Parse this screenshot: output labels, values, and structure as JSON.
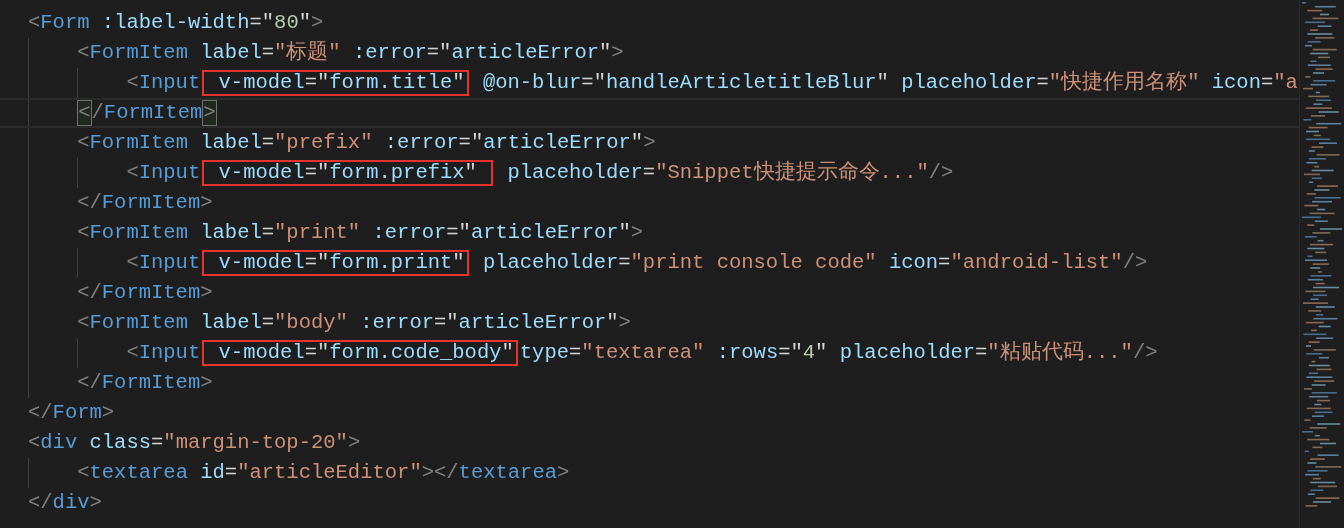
{
  "editor": {
    "lines": [
      {
        "tokens": [
          {
            "kind": "punct",
            "text": "<"
          },
          {
            "kind": "tag",
            "text": "Form"
          },
          {
            "kind": "attr",
            "text": " :label-width"
          },
          {
            "kind": "eq",
            "text": "=\""
          },
          {
            "kind": "num",
            "text": "80"
          },
          {
            "kind": "eq",
            "text": "\""
          },
          {
            "kind": "punct",
            "text": ">"
          }
        ],
        "children": [
          {
            "tokens": [
              {
                "kind": "punct",
                "text": "<"
              },
              {
                "kind": "tag",
                "text": "FormItem"
              },
              {
                "kind": "attr",
                "text": " label"
              },
              {
                "kind": "eq",
                "text": "="
              },
              {
                "kind": "str",
                "text": "\"标题\""
              },
              {
                "kind": "attr",
                "text": " :error"
              },
              {
                "kind": "eq",
                "text": "=\""
              },
              {
                "kind": "expr",
                "text": "articleError"
              },
              {
                "kind": "eq",
                "text": "\""
              },
              {
                "kind": "punct",
                "text": ">"
              }
            ],
            "children": [
              {
                "tokens": [
                  {
                    "kind": "punct",
                    "text": "<"
                  },
                  {
                    "kind": "tag",
                    "text": "Input"
                  },
                  {
                    "kind": "group",
                    "marked": true,
                    "tokens": [
                      {
                        "kind": "attr",
                        "text": " v-model"
                      },
                      {
                        "kind": "eq",
                        "text": "=\""
                      },
                      {
                        "kind": "expr",
                        "text": "form.title"
                      },
                      {
                        "kind": "eq",
                        "text": "\""
                      }
                    ]
                  },
                  {
                    "kind": "attr",
                    "text": " @on-blur"
                  },
                  {
                    "kind": "eq",
                    "text": "=\""
                  },
                  {
                    "kind": "expr",
                    "text": "handleArticletitleBlur"
                  },
                  {
                    "kind": "eq",
                    "text": "\""
                  },
                  {
                    "kind": "attr",
                    "text": " placeholder"
                  },
                  {
                    "kind": "eq",
                    "text": "="
                  },
                  {
                    "kind": "str",
                    "text": "\"快捷作用名称\""
                  },
                  {
                    "kind": "attr",
                    "text": " icon"
                  },
                  {
                    "kind": "eq",
                    "text": "="
                  },
                  {
                    "kind": "str",
                    "text": "\"a"
                  }
                ]
              }
            ]
          },
          {
            "current": true,
            "tokens": [
              {
                "kind": "punct",
                "text": "<",
                "bracket_match": true
              },
              {
                "kind": "punct",
                "text": "/"
              },
              {
                "kind": "tag",
                "text": "FormItem"
              },
              {
                "kind": "punct",
                "text": ">",
                "bracket_match": true
              }
            ]
          },
          {
            "tokens": [
              {
                "kind": "punct",
                "text": "<"
              },
              {
                "kind": "tag",
                "text": "FormItem"
              },
              {
                "kind": "attr",
                "text": " label"
              },
              {
                "kind": "eq",
                "text": "="
              },
              {
                "kind": "str",
                "text": "\"prefix\""
              },
              {
                "kind": "attr",
                "text": " :error"
              },
              {
                "kind": "eq",
                "text": "=\""
              },
              {
                "kind": "expr",
                "text": "articleError"
              },
              {
                "kind": "eq",
                "text": "\""
              },
              {
                "kind": "punct",
                "text": ">"
              }
            ],
            "children": [
              {
                "tokens": [
                  {
                    "kind": "punct",
                    "text": "<"
                  },
                  {
                    "kind": "tag",
                    "text": "Input"
                  },
                  {
                    "kind": "group",
                    "marked": true,
                    "tokens": [
                      {
                        "kind": "attr",
                        "text": " v-model"
                      },
                      {
                        "kind": "eq",
                        "text": "=\""
                      },
                      {
                        "kind": "expr",
                        "text": "form.prefix"
                      },
                      {
                        "kind": "eq",
                        "text": "\" "
                      }
                    ]
                  },
                  {
                    "kind": "attr",
                    "text": " placeholder"
                  },
                  {
                    "kind": "eq",
                    "text": "="
                  },
                  {
                    "kind": "str",
                    "text": "\"Snippet快捷提示命令...\""
                  },
                  {
                    "kind": "punct",
                    "text": "/>"
                  }
                ]
              }
            ]
          },
          {
            "tokens": [
              {
                "kind": "punct",
                "text": "</"
              },
              {
                "kind": "tag",
                "text": "FormItem"
              },
              {
                "kind": "punct",
                "text": ">"
              }
            ]
          },
          {
            "tokens": [
              {
                "kind": "punct",
                "text": "<"
              },
              {
                "kind": "tag",
                "text": "FormItem"
              },
              {
                "kind": "attr",
                "text": " label"
              },
              {
                "kind": "eq",
                "text": "="
              },
              {
                "kind": "str",
                "text": "\"print\""
              },
              {
                "kind": "attr",
                "text": " :error"
              },
              {
                "kind": "eq",
                "text": "=\""
              },
              {
                "kind": "expr",
                "text": "articleError"
              },
              {
                "kind": "eq",
                "text": "\""
              },
              {
                "kind": "punct",
                "text": ">"
              }
            ],
            "children": [
              {
                "tokens": [
                  {
                    "kind": "punct",
                    "text": "<"
                  },
                  {
                    "kind": "tag",
                    "text": "Input"
                  },
                  {
                    "kind": "group",
                    "marked": true,
                    "tokens": [
                      {
                        "kind": "attr",
                        "text": " v-model"
                      },
                      {
                        "kind": "eq",
                        "text": "=\""
                      },
                      {
                        "kind": "expr",
                        "text": "form.print"
                      },
                      {
                        "kind": "eq",
                        "text": "\""
                      }
                    ]
                  },
                  {
                    "kind": "attr",
                    "text": " placeholder"
                  },
                  {
                    "kind": "eq",
                    "text": "="
                  },
                  {
                    "kind": "str",
                    "text": "\"print console code\""
                  },
                  {
                    "kind": "attr",
                    "text": " icon"
                  },
                  {
                    "kind": "eq",
                    "text": "="
                  },
                  {
                    "kind": "str",
                    "text": "\"android-list\""
                  },
                  {
                    "kind": "punct",
                    "text": "/>"
                  }
                ]
              }
            ]
          },
          {
            "tokens": [
              {
                "kind": "punct",
                "text": "</"
              },
              {
                "kind": "tag",
                "text": "FormItem"
              },
              {
                "kind": "punct",
                "text": ">"
              }
            ]
          },
          {
            "tokens": [
              {
                "kind": "punct",
                "text": "<"
              },
              {
                "kind": "tag",
                "text": "FormItem"
              },
              {
                "kind": "attr",
                "text": " label"
              },
              {
                "kind": "eq",
                "text": "="
              },
              {
                "kind": "str",
                "text": "\"body\""
              },
              {
                "kind": "attr",
                "text": " :error"
              },
              {
                "kind": "eq",
                "text": "=\""
              },
              {
                "kind": "expr",
                "text": "articleError"
              },
              {
                "kind": "eq",
                "text": "\""
              },
              {
                "kind": "punct",
                "text": ">"
              }
            ],
            "children": [
              {
                "tokens": [
                  {
                    "kind": "punct",
                    "text": "<"
                  },
                  {
                    "kind": "tag",
                    "text": "Input"
                  },
                  {
                    "kind": "group",
                    "marked": true,
                    "tokens": [
                      {
                        "kind": "attr",
                        "text": " v-model"
                      },
                      {
                        "kind": "eq",
                        "text": "=\""
                      },
                      {
                        "kind": "expr",
                        "text": "form.code_body"
                      },
                      {
                        "kind": "eq",
                        "text": "\""
                      }
                    ]
                  },
                  {
                    "kind": "attr",
                    "text": "type"
                  },
                  {
                    "kind": "eq",
                    "text": "="
                  },
                  {
                    "kind": "str",
                    "text": "\"textarea\""
                  },
                  {
                    "kind": "attr",
                    "text": " :rows"
                  },
                  {
                    "kind": "eq",
                    "text": "=\""
                  },
                  {
                    "kind": "num",
                    "text": "4"
                  },
                  {
                    "kind": "eq",
                    "text": "\""
                  },
                  {
                    "kind": "attr",
                    "text": " placeholder"
                  },
                  {
                    "kind": "eq",
                    "text": "="
                  },
                  {
                    "kind": "str",
                    "text": "\"粘贴代码...\""
                  },
                  {
                    "kind": "punct",
                    "text": "/>"
                  }
                ]
              }
            ]
          },
          {
            "tokens": [
              {
                "kind": "punct",
                "text": "</"
              },
              {
                "kind": "tag",
                "text": "FormItem"
              },
              {
                "kind": "punct",
                "text": ">"
              }
            ]
          }
        ]
      },
      {
        "tokens": [
          {
            "kind": "punct",
            "text": "</"
          },
          {
            "kind": "tag",
            "text": "Form"
          },
          {
            "kind": "punct",
            "text": ">"
          }
        ]
      },
      {
        "tokens": [
          {
            "kind": "punct",
            "text": "<"
          },
          {
            "kind": "tag",
            "text": "div"
          },
          {
            "kind": "attr",
            "text": " class"
          },
          {
            "kind": "eq",
            "text": "="
          },
          {
            "kind": "str",
            "text": "\"margin-top-20\""
          },
          {
            "kind": "punct",
            "text": ">"
          }
        ],
        "children": [
          {
            "tokens": [
              {
                "kind": "punct",
                "text": "<"
              },
              {
                "kind": "tag",
                "text": "textarea"
              },
              {
                "kind": "attr",
                "text": " id"
              },
              {
                "kind": "eq",
                "text": "="
              },
              {
                "kind": "str",
                "text": "\"articleEditor\""
              },
              {
                "kind": "punct",
                "text": "></"
              },
              {
                "kind": "tag",
                "text": "textarea"
              },
              {
                "kind": "punct",
                "text": ">"
              }
            ]
          }
        ]
      },
      {
        "tokens": [
          {
            "kind": "punct",
            "text": "</"
          },
          {
            "kind": "tag",
            "text": "div"
          },
          {
            "kind": "punct",
            "text": ">"
          }
        ]
      }
    ]
  }
}
